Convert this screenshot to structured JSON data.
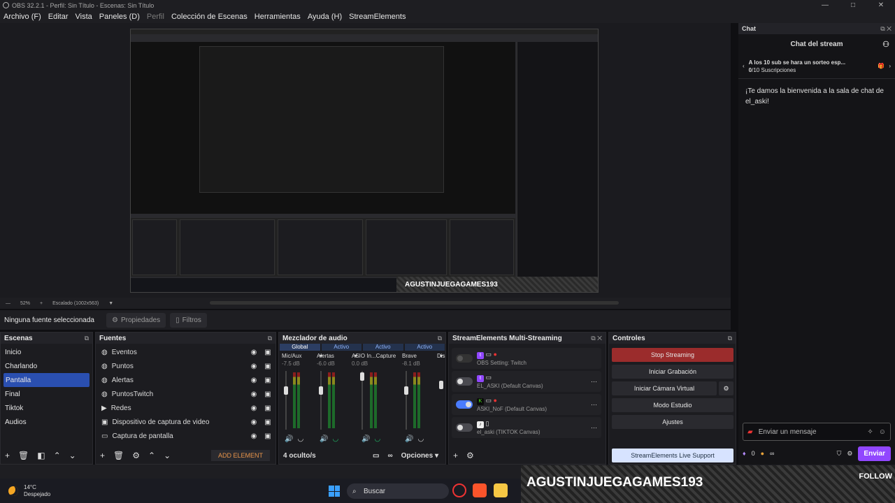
{
  "window": {
    "title": "OBS 32.2.1 - Perfil: Sin Título - Escenas: Sin Título",
    "controls": [
      "—",
      "□",
      "✕"
    ]
  },
  "menu": [
    {
      "label": "Archivo (F)",
      "enabled": true
    },
    {
      "label": "Editar",
      "enabled": true
    },
    {
      "label": "Vista",
      "enabled": true
    },
    {
      "label": "Paneles (D)",
      "enabled": true
    },
    {
      "label": "Perfil",
      "enabled": false
    },
    {
      "label": "Colección de Escenas",
      "enabled": true
    },
    {
      "label": "Herramientas",
      "enabled": true
    },
    {
      "label": "Ayuda (H)",
      "enabled": true
    },
    {
      "label": "StreamElements",
      "enabled": true
    }
  ],
  "preview": {
    "zoom": "52%",
    "scale": "Escalado (1002x563)",
    "overlay_name": "AGUSTINJUEGAGAMES193",
    "overlay_follow": "FOLLOW"
  },
  "source_bar": {
    "selected": "Ninguna fuente seleccionada",
    "properties": "Propiedades",
    "filters": "Filtros"
  },
  "scenes": {
    "title": "Escenas",
    "items": [
      "Inicio",
      "Charlando",
      "Pantalla",
      "Final",
      "Tiktok",
      "Audios"
    ],
    "active": "Pantalla"
  },
  "sources": {
    "title": "Fuentes",
    "items": [
      {
        "name": "Eventos",
        "icon": "globe"
      },
      {
        "name": "Puntos",
        "icon": "globe"
      },
      {
        "name": "Alertas",
        "icon": "globe"
      },
      {
        "name": "PuntosTwitch",
        "icon": "globe"
      },
      {
        "name": "Redes",
        "icon": "play"
      },
      {
        "name": "Dispositivo de captura de video",
        "icon": "camera"
      },
      {
        "name": "Captura de pantalla",
        "icon": "monitor"
      }
    ],
    "add_element": "ADD ELEMENT"
  },
  "mixer": {
    "title": "Mezclador de audio",
    "tabs": [
      "Global",
      "Activo",
      "Activo",
      "Activo"
    ],
    "channels": [
      {
        "name": "Mic/Aux",
        "db": "-7.5 dB"
      },
      {
        "name": "Alertas",
        "db": "-6.0 dB"
      },
      {
        "name": "ASIO In...Capture",
        "db": "0.0 dB"
      },
      {
        "name": "Brave",
        "db": "-8.1 dB"
      },
      {
        "name": "Dis",
        "db": ""
      }
    ],
    "scale": [
      "0",
      "-6",
      "-12",
      "-18",
      "-24",
      "-30",
      "-36",
      "-42",
      "-48",
      "-54",
      "-60"
    ],
    "hidden": "4 oculto/s",
    "options": "Opciones"
  },
  "multistream": {
    "title": "StreamElements Multi-Streaming",
    "outputs": [
      {
        "label": "OBS Setting: Twitch",
        "state": "disabled",
        "platform": "twitch"
      },
      {
        "label": "EL_ASKI (Default Canvas)",
        "state": "off",
        "platform": "twitch"
      },
      {
        "label": "ASKI_NoF (Default Canvas)",
        "state": "on",
        "platform": "kick"
      },
      {
        "label": "el_aski (TIKTOK Canvas)",
        "state": "off",
        "platform": "tiktok"
      }
    ]
  },
  "controls": {
    "title": "Controles",
    "buttons": [
      "Stop Streaming",
      "Iniciar Grabación",
      "Iniciar Cámara Virtual",
      "Modo Estudio",
      "Ajustes"
    ],
    "support": "StreamElements Live Support"
  },
  "chat": {
    "dock_title": "Chat",
    "title": "Chat del stream",
    "sub_goal_title": "A los 10 sub se hara un sorteo esp...",
    "sub_goal_progress": "0/10 Suscripciones",
    "sub_goal_count": "0",
    "sub_goal_rest": "/10 Suscripciones",
    "welcome": "¡Te damos la bienvenida a la sala de chat de el_aski!",
    "input_placeholder": "Enviar un mensaje",
    "points": "0",
    "send": "Enviar"
  },
  "taskbar": {
    "temp": "14°C",
    "weather": "Despejado",
    "search": "Buscar"
  },
  "colors": {
    "accent": "#2a4fb0",
    "stop": "#9b2c2c",
    "twitch": "#9147ff",
    "kick": "#53fc18",
    "support": "#d7e3ff"
  }
}
